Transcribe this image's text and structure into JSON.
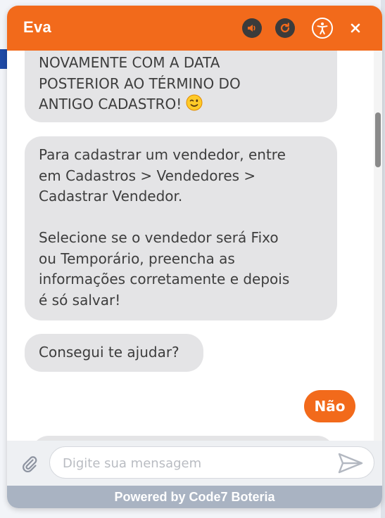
{
  "header": {
    "title": "Eva",
    "icons": [
      "volume-icon",
      "refresh-icon",
      "accessibility-icon",
      "close-icon"
    ],
    "close_glyph": "×"
  },
  "messages": [
    {
      "from": "bot",
      "text": "NOVAMENTE COM A DATA\nPOSTERIOR AO TÉRMINO DO\nANTIGO CADASTRO!",
      "emoji": "winking-face"
    },
    {
      "from": "bot",
      "text": "Para cadastrar um vendedor, entre\nem Cadastros > Vendedores >\nCadastrar Vendedor.\n\nSelecione se o vendedor será Fixo\nou Temporário, preencha as\ninformações corretamente e depois\né só salvar!"
    },
    {
      "from": "bot",
      "text": "Consegui te ajudar?"
    },
    {
      "from": "user",
      "text": "Não"
    }
  ],
  "input": {
    "placeholder": "Digite sua mensagem",
    "value": ""
  },
  "footer": {
    "text": "Powered by Code7 Boteria"
  },
  "colors": {
    "brand": "#f26a1b",
    "bubble": "#e4e4e6",
    "footer": "#a9b3c2"
  }
}
